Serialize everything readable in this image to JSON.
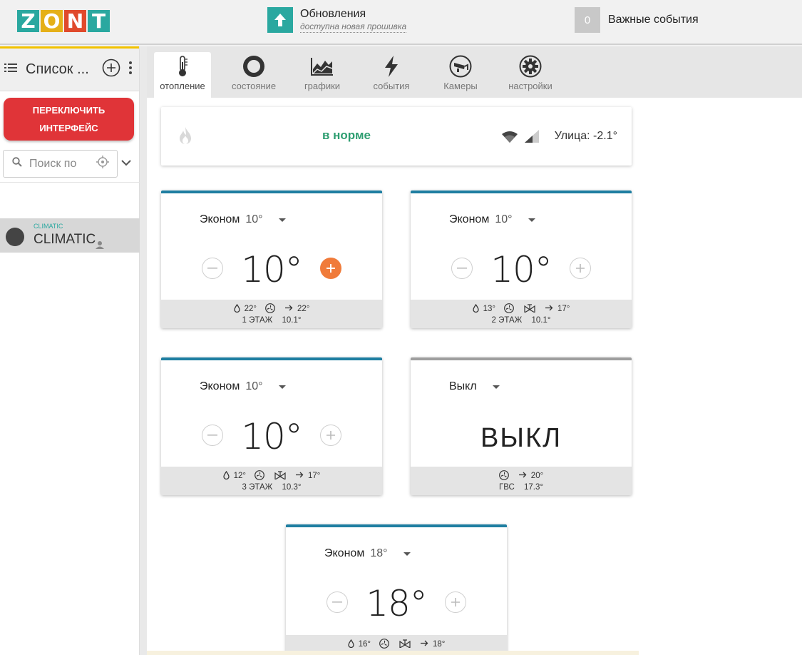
{
  "logo": {
    "letters": [
      "Z",
      "O",
      "N",
      "T"
    ],
    "colors": [
      "#2aa8a0",
      "#e5b018",
      "#e04a2c",
      "#2aa8a0"
    ]
  },
  "updates": {
    "title": "Обновления",
    "subtitle": "доступна новая прошивка"
  },
  "events": {
    "count": "0",
    "label": "Важные события"
  },
  "sidebar": {
    "title": "Список ...",
    "switch_line1": "ПЕРЕКЛЮЧИТЬ",
    "switch_line2": "ИНТЕРФЕЙС",
    "search_placeholder": "Поиск по",
    "device": {
      "small": "CLIMATIC",
      "name": "CLIMATIC"
    }
  },
  "tabs": [
    {
      "label": "отопление",
      "icon": "thermometer-icon",
      "active": true
    },
    {
      "label": "состояние",
      "icon": "circle-icon"
    },
    {
      "label": "графики",
      "icon": "chart-icon"
    },
    {
      "label": "события",
      "icon": "lightning-icon"
    },
    {
      "label": "Камеры",
      "icon": "camera-icon"
    },
    {
      "label": "настройки",
      "icon": "gear-icon"
    }
  ],
  "status": {
    "state": "в норме",
    "street": "Улица: -2.1°"
  },
  "zones": [
    {
      "mode": "Эконом",
      "mode_value": "10°",
      "temp": "10°",
      "humidity": "22°",
      "target": "22°",
      "name": "1 ЭТАЖ",
      "current": "10.1°",
      "plus_active": true
    },
    {
      "mode": "Эконом",
      "mode_value": "10°",
      "temp": "10°",
      "humidity": "13°",
      "target": "17°",
      "name": "2 ЭТАЖ",
      "current": "10.1°"
    },
    {
      "mode": "Эконом",
      "mode_value": "10°",
      "temp": "10°",
      "humidity": "12°",
      "target": "17°",
      "name": "3 ЭТАЖ",
      "current": "10.3°"
    },
    {
      "mode": "Выкл",
      "off_text": "ВЫКЛ",
      "target": "20°",
      "name": "ГВС",
      "current": "17.3°"
    },
    {
      "mode": "Эконом",
      "mode_value": "18°",
      "temp": "18°",
      "humidity": "16°",
      "target": "18°"
    }
  ]
}
